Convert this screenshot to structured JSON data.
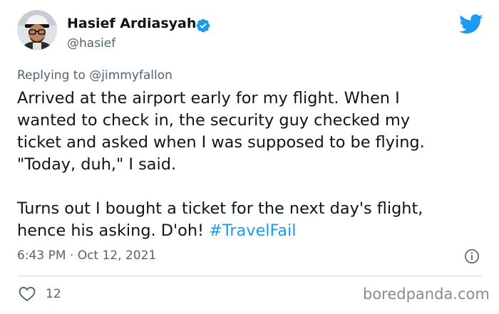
{
  "author": {
    "display_name": "Hasief Ardiasyah",
    "handle": "@hasief",
    "verified": true
  },
  "reply": {
    "prefix": "Replying to ",
    "to_handle": "@jimmyfallon"
  },
  "tweet": {
    "lines_para1": [
      "Arrived at the airport early for my flight. When I",
      "wanted to check in, the  security guy checked my",
      "ticket and asked when I was supposed to be flying.",
      "\"Today, duh,\" I said."
    ],
    "para2_line1": "Turns out I bought a ticket for the next day's flight,",
    "para2_line2_text": "hence his asking. D'oh! ",
    "hashtag": "#TravelFail"
  },
  "meta": {
    "timestamp": "6:43 PM · Oct 12, 2021"
  },
  "stats": {
    "likes": "12"
  },
  "watermark": "boredpanda.com",
  "colors": {
    "accent": "#1d9bf0",
    "text": "#0f1419",
    "secondary": "#536471",
    "divider": "#cfd9de"
  },
  "icons": {
    "brand": "twitter-bird-icon",
    "verified": "verified-badge-icon",
    "info": "info-icon",
    "like": "heart-icon"
  }
}
